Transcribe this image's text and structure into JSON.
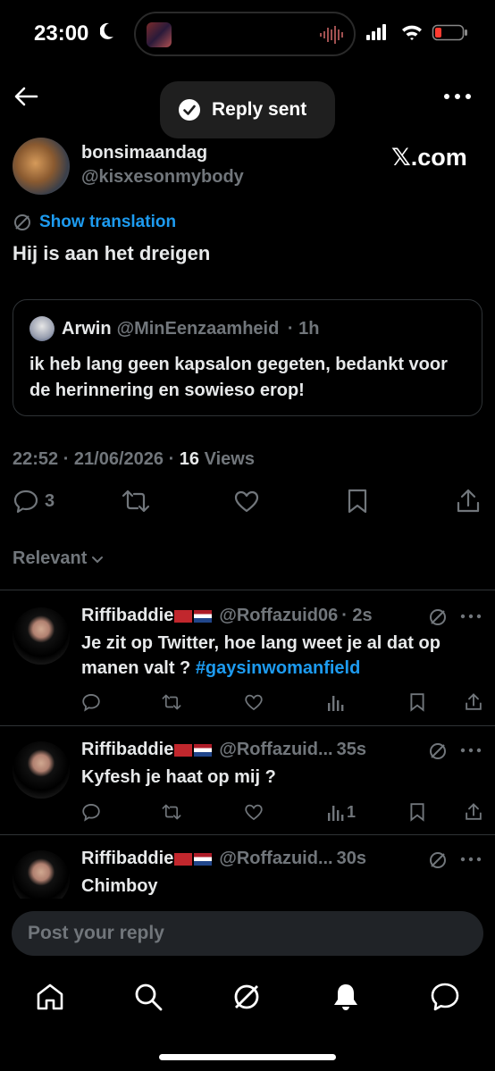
{
  "status_bar": {
    "time": "23:00"
  },
  "toast": {
    "text": "Reply sent"
  },
  "post": {
    "author_name": "bonsimaandag",
    "author_handle": "@kisxesonmybody",
    "watermark": "𝕏.com",
    "translate_label": "Show translation",
    "text": "Hij is aan het dreigen",
    "quote": {
      "name": "Arwin",
      "handle": "@MinEenzaamheid",
      "time": "· 1h",
      "text": "ik heb lang geen kapsalon gegeten, bedankt voor de herinnering en sowieso erop!"
    },
    "timestamp": "22:52 · 21/06/2026 · ",
    "views_count": "16",
    "views_label": " Views",
    "reply_count": "3"
  },
  "sort": {
    "label": "Relevant"
  },
  "replies": [
    {
      "name": "Riffibaddie",
      "handle": "@Roffazuid06",
      "time": "· 2s",
      "text_before": "Je zit op Twitter, hoe lang weet je al dat op manen valt ? ",
      "hashtag": "#gaysinwomanfield",
      "views": ""
    },
    {
      "name": "Riffibaddie",
      "handle": "@Roffazuid...",
      "time": "35s",
      "text_before": "Kyfesh je haat op mij ?",
      "hashtag": "",
      "views": "1"
    },
    {
      "name": "Riffibaddie",
      "handle": "@Roffazuid...",
      "time": "30s",
      "text_before": "Chimboy",
      "hashtag": "",
      "views": ""
    }
  ],
  "composer": {
    "placeholder": "Post your reply"
  },
  "colors": {
    "accent": "#1d9bf0",
    "muted": "#71767b",
    "text": "#e7e9ea",
    "background": "#000000"
  },
  "icons": [
    "back-arrow-icon",
    "more-icon",
    "checkmark-icon",
    "translate-icon",
    "reply-icon",
    "retweet-icon",
    "like-icon",
    "bookmark-icon",
    "share-icon",
    "views-icon",
    "grok-icon",
    "home-icon",
    "search-icon",
    "bell-icon",
    "messages-icon"
  ]
}
